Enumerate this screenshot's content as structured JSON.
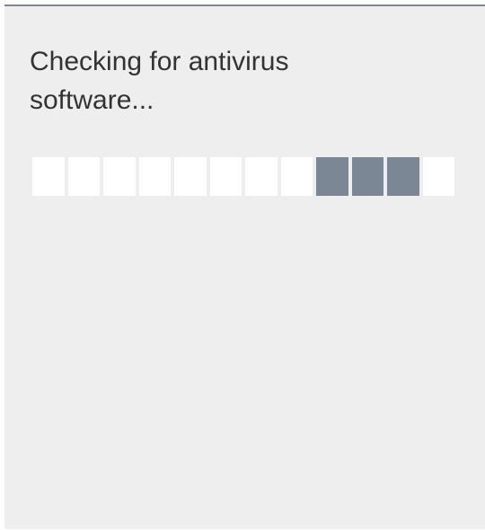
{
  "dialog": {
    "status_text": "Checking for antivirus software..."
  },
  "progress": {
    "segments": 12,
    "active_segments": [
      9,
      10,
      11
    ],
    "active_color": "#7c8795",
    "inactive_color": "#ffffff",
    "style": "indeterminate-marquee"
  },
  "colors": {
    "panel_background": "#eeeeee",
    "panel_top_border": "#7d8796",
    "text": "#333333"
  }
}
